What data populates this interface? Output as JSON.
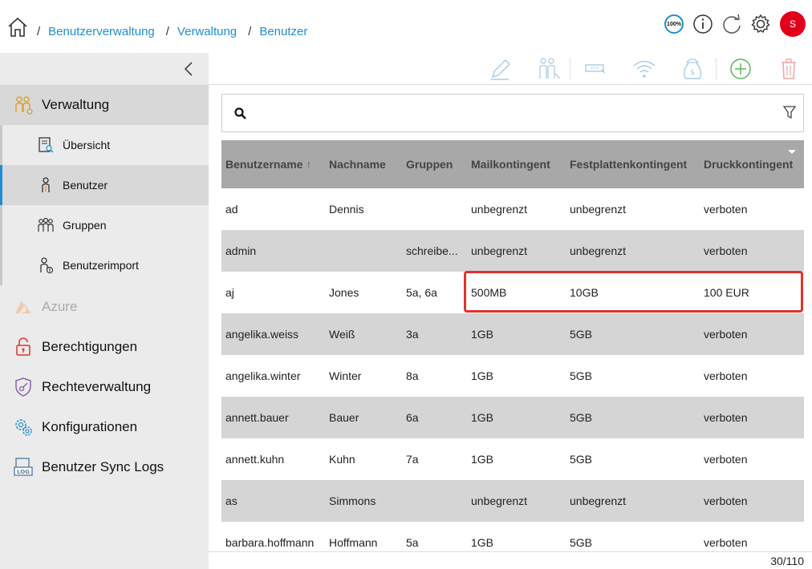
{
  "breadcrumb": [
    "Benutzerverwaltung",
    "Verwaltung",
    "Benutzer"
  ],
  "header_icons": {
    "quota_badge": "100%",
    "avatar_initial": "S",
    "avatar_color": "#e3001b"
  },
  "sidebar": {
    "sections": [
      {
        "label": "Verwaltung",
        "icon": "users-admin-icon",
        "active": true
      },
      {
        "label": "Azure",
        "icon": "azure-icon",
        "disabled": true
      },
      {
        "label": "Berechtigungen",
        "icon": "lock-icon"
      },
      {
        "label": "Rechteverwaltung",
        "icon": "shield-key-icon"
      },
      {
        "label": "Konfigurationen",
        "icon": "gears-icon"
      },
      {
        "label": "Benutzer Sync Logs",
        "icon": "log-icon"
      }
    ],
    "subitems": [
      {
        "label": "Übersicht",
        "icon": "overview-icon"
      },
      {
        "label": "Benutzer",
        "icon": "user-icon",
        "active": true
      },
      {
        "label": "Gruppen",
        "icon": "group-icon"
      },
      {
        "label": "Benutzerimport",
        "icon": "user-import-icon"
      }
    ]
  },
  "toolbar": [
    "edit-icon",
    "assign-group-icon",
    "password-icon",
    "wifi-icon",
    "quota-money-icon",
    "add-icon",
    "delete-icon"
  ],
  "search": {
    "value": "",
    "placeholder": ""
  },
  "table": {
    "columns": [
      "Benutzername",
      "Nachname",
      "Gruppen",
      "Mailkontingent",
      "Festplattenkontingent",
      "Druckkontingent"
    ],
    "rows": [
      [
        "ad",
        "Dennis",
        "",
        "unbegrenzt",
        "unbegrenzt",
        "verboten"
      ],
      [
        "admin",
        "",
        "schreibe...",
        "unbegrenzt",
        "unbegrenzt",
        "verboten"
      ],
      [
        "aj",
        "Jones",
        "5a, 6a",
        "500MB",
        "10GB",
        "100 EUR"
      ],
      [
        "angelika.weiss",
        "Weiß",
        "3a",
        "1GB",
        "5GB",
        "verboten"
      ],
      [
        "angelika.winter",
        "Winter",
        "8a",
        "1GB",
        "5GB",
        "verboten"
      ],
      [
        "annett.bauer",
        "Bauer",
        "6a",
        "1GB",
        "5GB",
        "verboten"
      ],
      [
        "annett.kuhn",
        "Kuhn",
        "7a",
        "1GB",
        "5GB",
        "verboten"
      ],
      [
        "as",
        "Simmons",
        "",
        "unbegrenzt",
        "unbegrenzt",
        "verboten"
      ],
      [
        "barbara.hoffmann",
        "Hoffmann",
        "5a",
        "1GB",
        "5GB",
        "verboten"
      ]
    ],
    "pager": "30/110"
  },
  "colors": {
    "link": "#1f8fd1",
    "header_bg": "#a8a8a8",
    "alt_row": "#d5d5d5",
    "highlight": "#e0322b",
    "add": "#5cb85c",
    "delete": "#f2a3a3"
  }
}
